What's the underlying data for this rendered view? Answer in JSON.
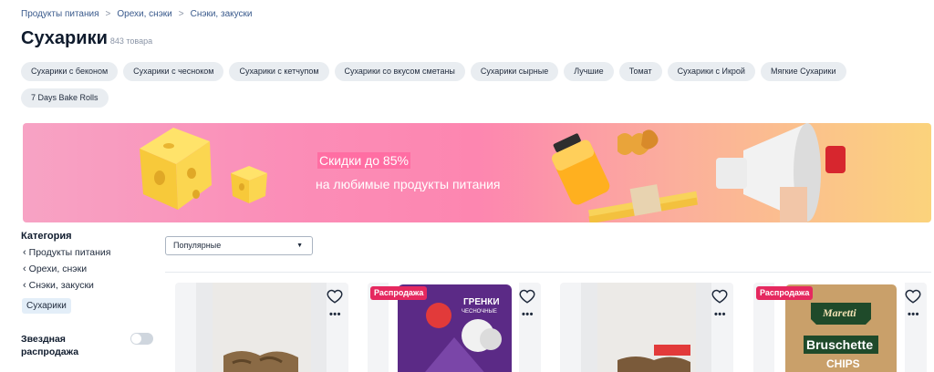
{
  "breadcrumb": [
    "Продукты питания",
    "Орехи, снэки",
    "Снэки, закуски"
  ],
  "title": "Сухарики",
  "product_count": "843 товара",
  "chips": [
    "Сухарики с беконом",
    "Сухарики с чесноком",
    "Сухарики с кетчупом",
    "Сухарики со вкусом сметаны",
    "Сухарики сырные",
    "Лучшие",
    "Томат",
    "Сухарики с Икрой",
    "Мягкие Сухарики",
    "7 Days Bake Rolls"
  ],
  "banner": {
    "headline": "Скидки до 85%",
    "subtitle": "на любимые продукты питания"
  },
  "sidebar": {
    "category_title": "Категория",
    "links": [
      "Продукты питания",
      "Орехи, снэки",
      "Снэки, закуски"
    ],
    "active": "Сухарики",
    "toggle_label": "Звездная распродажа",
    "toggle_on": false
  },
  "sort": {
    "selected": "Популярные"
  },
  "cards": [
    {
      "badge": ""
    },
    {
      "badge": "Распродажа",
      "packaging_text": [
        "ГРЕНКИ",
        "ЧЕСНОЧНЫЕ"
      ]
    },
    {
      "badge": ""
    },
    {
      "badge": "Распродажа",
      "packaging_text": [
        "Maretti",
        "Bruschette",
        "CHIPS"
      ]
    }
  ],
  "colors": {
    "accent_badge": "#e5295f",
    "chip_bg": "#e9edf1",
    "link": "#3a5a8c"
  }
}
